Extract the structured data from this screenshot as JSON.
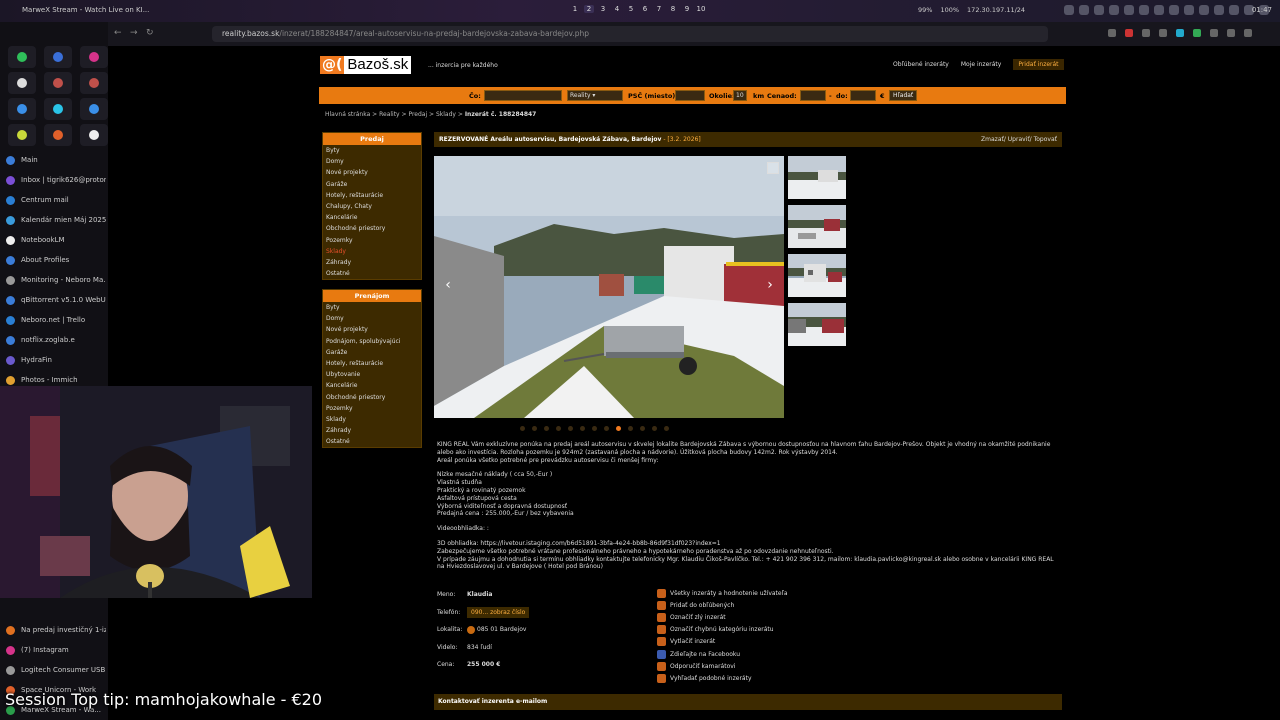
{
  "os": {
    "window_title": "MarweX Stream - Watch Live on KI...",
    "workspaces": [
      "1",
      "2",
      "3",
      "4",
      "5",
      "6",
      "7",
      "8",
      "9",
      "10"
    ],
    "active_workspace": "2",
    "stats": [
      "99%",
      "100%",
      "172.30.197.11/24"
    ],
    "clock": "01:47"
  },
  "sidebar": {
    "tabs": [
      {
        "label": "Main",
        "color": "#3b7dd8"
      },
      {
        "label": "Inbox | tigrik626@proton...",
        "color": "#7b4fd6"
      },
      {
        "label": "Centrum mail",
        "color": "#2a7fd4"
      },
      {
        "label": "Kalendár mien Máj 2025",
        "color": "#3a9bdc"
      },
      {
        "label": "NotebookLM",
        "color": "#eeeeee"
      },
      {
        "label": "About Profiles",
        "color": "#3b7dd8"
      },
      {
        "label": "Monitoring - Neboro Ma...",
        "color": "#999999"
      },
      {
        "label": "qBittorrent v5.1.0 WebUI",
        "color": "#3b7dd8"
      },
      {
        "label": "Neboro.net | Trello",
        "color": "#2a7fd4"
      },
      {
        "label": "notflix.zoglab.e",
        "color": "#3b7dd8"
      },
      {
        "label": "HydraFin",
        "color": "#6a5acd"
      },
      {
        "label": "Photos - Immich",
        "color": "#e0a030"
      }
    ],
    "tabs_low": [
      {
        "label": "Na predaj investičný 1-iz...",
        "color": "#e07020"
      },
      {
        "label": "(7) Instagram",
        "color": "#d6338a"
      },
      {
        "label": "Logitech Consumer USB...",
        "color": "#999999"
      },
      {
        "label": "Space Unicorn - Work",
        "color": "#e0602a"
      },
      {
        "label": "MarweX Stream - Wa...",
        "color": "#2a9d4a"
      }
    ]
  },
  "browser": {
    "url_host": "reality.bazos.sk",
    "url_path": "/inzerat/188284847/areal-autoservisu-na-predaj-bardejovska-zabava-bardejov.php"
  },
  "site": {
    "logo_at": "@(",
    "logo_name": "Bazoš.sk",
    "tagline": "... inzercia pre každého",
    "links": [
      "Obľúbené inzeráty",
      "Moje inzeráty"
    ],
    "add_link": "Pridať inzerát"
  },
  "search": {
    "co_label": "Čo:",
    "category": "Reality",
    "psc_label": "PSČ",
    "miesto_label": "(miesto):",
    "okolie_label": "Okolie:",
    "okolie_value": "10",
    "km_label": "km",
    "cena_label": "Cena",
    "od_label": "od:",
    "do_label": "do:",
    "currency": "€",
    "button": "Hľadať"
  },
  "breadcrumb": {
    "parts": "Hlavná stránka > Reality > Predaj > Sklady >",
    "current": "Inzerát č. 188284847"
  },
  "menu_predaj": {
    "title": "Predaj",
    "items": [
      "Byty",
      "Domy",
      "Nové projekty",
      "Garáže",
      "Hotely, reštaurácie",
      "Chalupy, Chaty",
      "Kancelárie",
      "Obchodné priestory",
      "Pozemky",
      "Sklady",
      "Záhrady",
      "Ostatné"
    ],
    "current": "Sklady"
  },
  "menu_prenajom": {
    "title": "Prenájom",
    "items": [
      "Byty",
      "Domy",
      "Nové projekty",
      "Podnájom, spolubývajúci",
      "Garáže",
      "Hotely, reštaurácie",
      "Ubytovanie",
      "Kancelárie",
      "Obchodné priestory",
      "Pozemky",
      "Sklady",
      "Záhrady",
      "Ostatné"
    ]
  },
  "listing": {
    "title": "REZERVOVANÉ Areálu autoservisu, Bardejovská Zábava, Bardejov",
    "date": "- [3.2. 2026]",
    "actions": "Zmazať/ Upraviť/ Topovať",
    "photo_count": 13,
    "active_photo": 9,
    "description": [
      "KING REAL Vám exkluzívne ponúka na predaj areál autoservisu v skvelej lokalite Bardejovská Zábava s výbornou dostupnosťou na hlavnom ťahu Bardejov-Prešov. Objekt je vhodný na okamžité podnikanie alebo ako investícia. Rozloha pozemku je 924m2 (zastavaná plocha a nádvorie). Úžitková plocha budovy 142m2. Rok výstavby 2014.\nAreál ponúka všetko potrebné pre prevádzku autoservisu či menšej firmy:",
      "Nízke mesačné náklady ( cca 50,-Eur )\nVlastná studňa\nPraktický a rovinatý pozemok\nAsfaltová prístupová cesta\nVýborná viditeľnosť a dopravná dostupnosť\nPredajná cena : 255.000,-Eur / bez vybavenia",
      "Videoobhliadka: :",
      "3D obhliadka: https://livetour.istaging.com/b6d51891-3bfa-4e24-bb8b-86d9f31df023?index=1\nZabezpečujeme všetko potrebné vrátane profesionálneho právneho a hypotekárneho poradenstva až po odovzdanie nehnuteľnosti.\nV prípade záujmu a dohodnutia si termínu obhliadky kontaktujte telefonicky Mgr. Klaudiu Čikoš-Pavlíčko. Tel.: + 421 902 396 312, mailom: klaudia.pavlicko@kingreal.sk alebo osobne v kancelárii KING REAL na Hviezdoslavovej ul. v Bardejove ( Hotel pod Bránou)"
    ],
    "details": {
      "meno_label": "Meno:",
      "meno": "Klaudia",
      "telefon_label": "Telefón:",
      "telefon": "090... zobraz číslo",
      "lokalita_label": "Lokalita:",
      "lokalita": "085 01 Bardejov",
      "videlo_label": "Videlo:",
      "videlo": "834 ľudí",
      "cena_label": "Cena:",
      "cena": "255 000 €"
    },
    "actions_list": [
      "Všetky inzeráty a hodnotenie užívateľa",
      "Pridať do obľúbených",
      "Označiť zlý inzerát",
      "Označiť chybnú kategóriu inzerátu",
      "Vytlačiť inzerát",
      "Zdieľajte na Facebooku",
      "Odporučiť kamarátovi",
      "Vyhľadať podobné inzeráty"
    ],
    "contact_bar": "Kontaktovať inzerenta e-mailom"
  },
  "overlay": {
    "top_tip": "Session Top tip: mamhojakowhale - €20"
  }
}
